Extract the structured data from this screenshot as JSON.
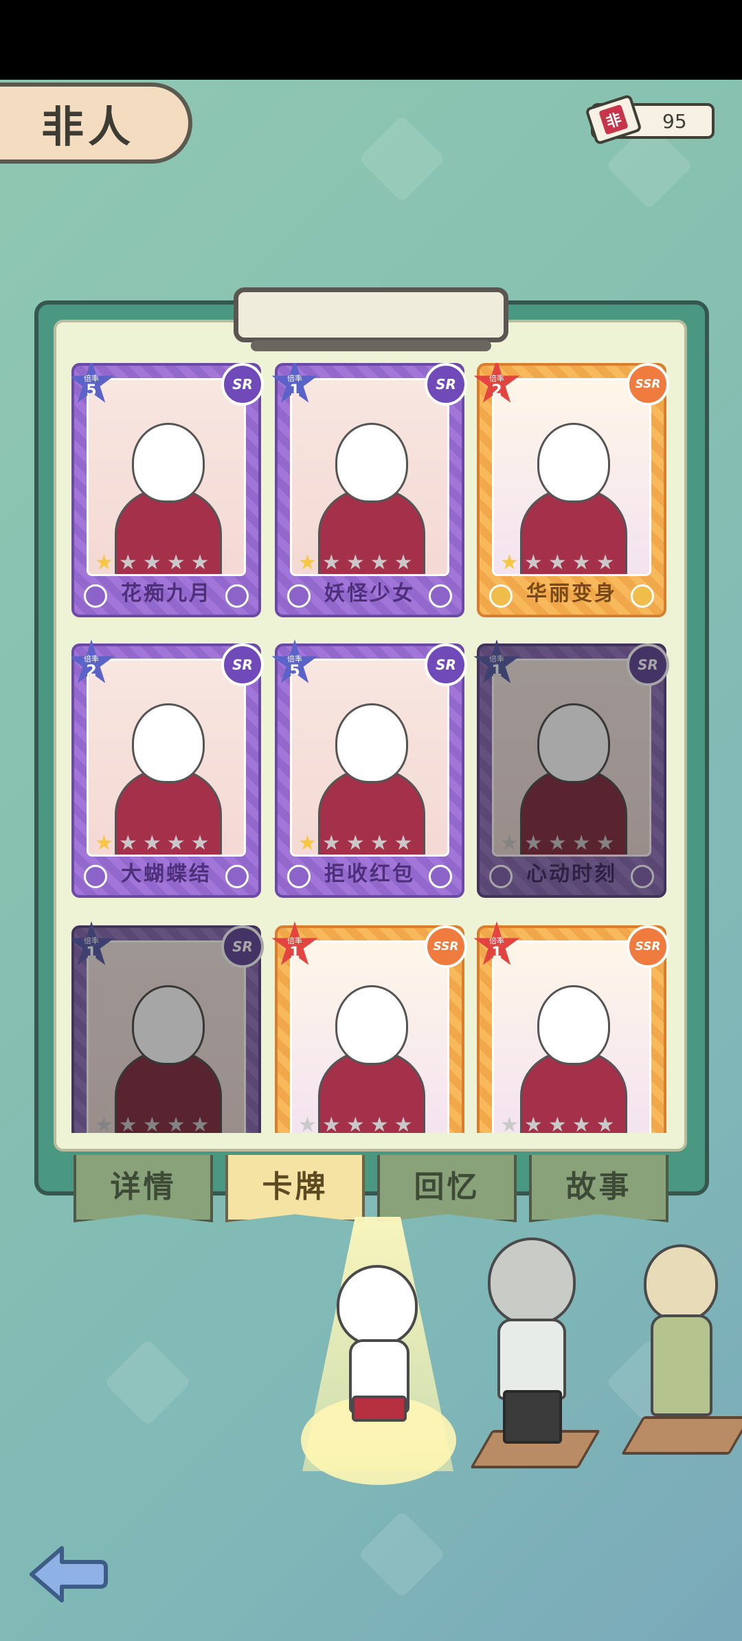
{
  "header": {
    "title": "非人",
    "ticket_label": "非",
    "ticket_count": "95"
  },
  "cards": [
    {
      "name": "花痴九月",
      "rarity": "SR",
      "multiplier_label": "倍率",
      "multiplier": "5",
      "stars_filled": 1,
      "stars_total": 5,
      "locked": false
    },
    {
      "name": "妖怪少女",
      "rarity": "SR",
      "multiplier_label": "倍率",
      "multiplier": "1",
      "stars_filled": 1,
      "stars_total": 5,
      "locked": false
    },
    {
      "name": "华丽变身",
      "rarity": "SSR",
      "multiplier_label": "倍率",
      "multiplier": "2",
      "stars_filled": 1,
      "stars_total": 5,
      "locked": false
    },
    {
      "name": "大蝴蝶结",
      "rarity": "SR",
      "multiplier_label": "倍率",
      "multiplier": "2",
      "stars_filled": 1,
      "stars_total": 5,
      "locked": false
    },
    {
      "name": "拒收红包",
      "rarity": "SR",
      "multiplier_label": "倍率",
      "multiplier": "5",
      "stars_filled": 1,
      "stars_total": 5,
      "locked": false
    },
    {
      "name": "心动时刻",
      "rarity": "SR",
      "multiplier_label": "倍率",
      "multiplier": "1",
      "stars_filled": 0,
      "stars_total": 5,
      "locked": true
    },
    {
      "name": "",
      "rarity": "SR",
      "multiplier_label": "倍率",
      "multiplier": "1",
      "stars_filled": 0,
      "stars_total": 5,
      "locked": true
    },
    {
      "name": "",
      "rarity": "SSR",
      "multiplier_label": "倍率",
      "multiplier": "1",
      "stars_filled": 0,
      "stars_total": 5,
      "locked": false
    },
    {
      "name": "",
      "rarity": "SSR",
      "multiplier_label": "倍率",
      "multiplier": "1",
      "stars_filled": 0,
      "stars_total": 5,
      "locked": false
    }
  ],
  "tabs": [
    {
      "label": "详情",
      "active": false
    },
    {
      "label": "卡牌",
      "active": true
    },
    {
      "label": "回忆",
      "active": false
    },
    {
      "label": "故事",
      "active": false
    }
  ],
  "colors": {
    "background": "#86c0b0",
    "board": "#4a9782",
    "sr_card": "#a276d8",
    "ssr_card": "#f7b95b",
    "star_on": "#f7c744",
    "tab_active": "#f4e3a2"
  },
  "icons": {
    "back": "back-arrow-icon",
    "ticket": "ticket-icon"
  }
}
